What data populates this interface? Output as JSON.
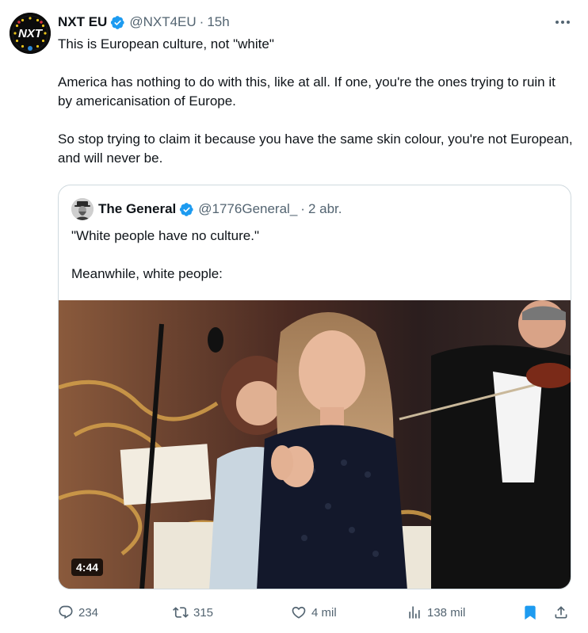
{
  "tweet": {
    "author": {
      "name": "NXT EU",
      "handle": "@NXT4EU",
      "avatar_text": "NXT",
      "verified_color": "#1d9bf0"
    },
    "separator": "·",
    "time": "15h",
    "paragraphs": [
      "This is European culture, not \"white\"",
      "America has nothing to do with this, like at all. If one, you're the ones trying to ruin it by americanisation of Europe.",
      "So stop trying to claim it because you have the same skin colour, you're not European, and will never be."
    ],
    "quoted": {
      "author": {
        "name": "The General",
        "handle": "@1776General_"
      },
      "separator": "·",
      "time": "2 abr.",
      "paragraphs": [
        "\"White people have no culture.\"",
        "Meanwhile, white people:"
      ],
      "video": {
        "duration": "4:44"
      }
    },
    "actions": {
      "replies": "234",
      "reposts": "315",
      "likes": "4 mil",
      "views": "138 mil"
    }
  },
  "colors": {
    "text": "#0f1419",
    "secondary": "#536471",
    "accent": "#1d9bf0",
    "border": "#cfd9de"
  },
  "icons": [
    "more-icon",
    "verified-icon",
    "reply-icon",
    "retweet-icon",
    "like-icon",
    "views-icon",
    "bookmark-icon",
    "share-icon"
  ]
}
